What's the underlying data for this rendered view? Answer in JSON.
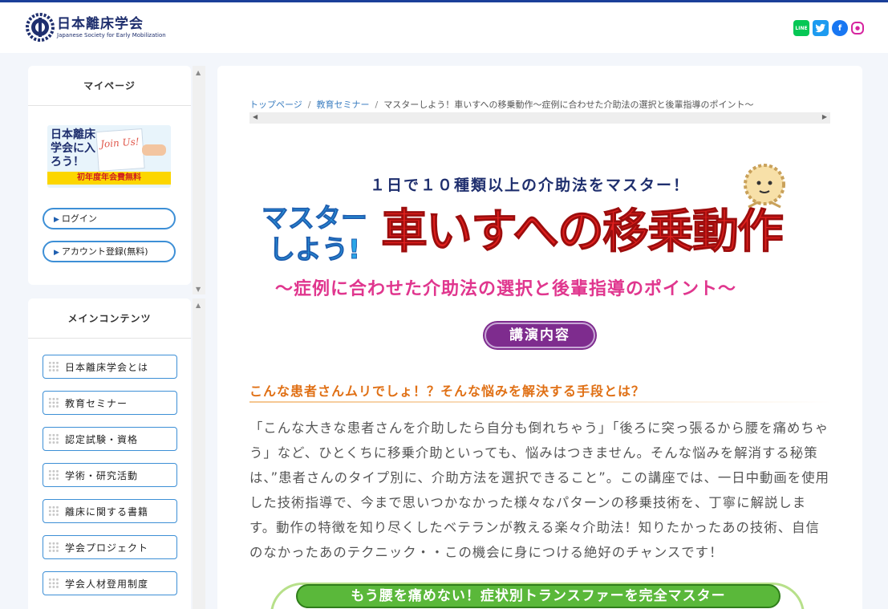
{
  "header": {
    "logo_jp": "日本離床学会",
    "logo_en": "Japanese Society for Early Mobilization",
    "social": [
      "line-icon",
      "twitter-icon",
      "facebook-icon",
      "instagram-icon"
    ]
  },
  "sidebar": {
    "mypage_title": "マイページ",
    "join_banner": {
      "text": "日本離床学会に入ろう！",
      "card": "Join Us!",
      "free_label": "初年度年会費無料"
    },
    "login_label": "ログイン",
    "register_label": "アカウント登録(無料)",
    "main_contents_title": "メインコンテンツ",
    "nav_items": [
      {
        "label": "日本離床学会とは"
      },
      {
        "label": "教育セミナー"
      },
      {
        "label": "認定試験・資格"
      },
      {
        "label": "学術・研究活動"
      },
      {
        "label": "離床に関する書籍"
      },
      {
        "label": "学会プロジェクト"
      },
      {
        "label": "学会人材登用制度"
      }
    ]
  },
  "breadcrumb": {
    "home": "トップページ",
    "seminar": "教育セミナー",
    "current": "マスターしよう！車いすへの移乗動作〜症例に合わせた介助法の選択と後輩指導のポイント〜"
  },
  "hero": {
    "subtitle": "１日で１０種類以上の介助法をマスター！",
    "master_line1": "マスター",
    "master_line2": "しよう!",
    "title": "車いすへの移乗動作",
    "tagline": "〜症例に合わせた介助法の選択と後輩指導のポイント〜"
  },
  "content": {
    "lecture_badge": "講演内容",
    "section_heading": "こんな患者さんムリでしょ！？そんな悩みを解決する手段とは？",
    "body": "「こんな大きな患者さんを介助したら自分も倒れちゃう」「後ろに突っ張るから腰を痛めちゃう」など、ひとくちに移乗介助といっても、悩みはつきません。そんな悩みを解消する秘策は、”患者さんのタイプ別に、介助方法を選択できること”。この講座では、一日中動画を使用した技術指導で、今まで思いつかなかった様々なパターンの移乗技術を、丁寧に解説します。動作の特徴を知り尽くしたベテランが教える楽々介助法！知りたかったあの技術、自信のなかったあのテクニック・・この機会に身につける絶好のチャンスです！",
    "green_banner": "もう腰を痛めない！症状別トランスファーを完全マスター"
  },
  "colors": {
    "brand_navy": "#1f2f6e",
    "accent_blue": "#3d8fd6",
    "title_red": "#e0201e",
    "heading_orange": "#e07015",
    "badge_purple": "#7e2c8e",
    "banner_green": "#5ab83a"
  }
}
